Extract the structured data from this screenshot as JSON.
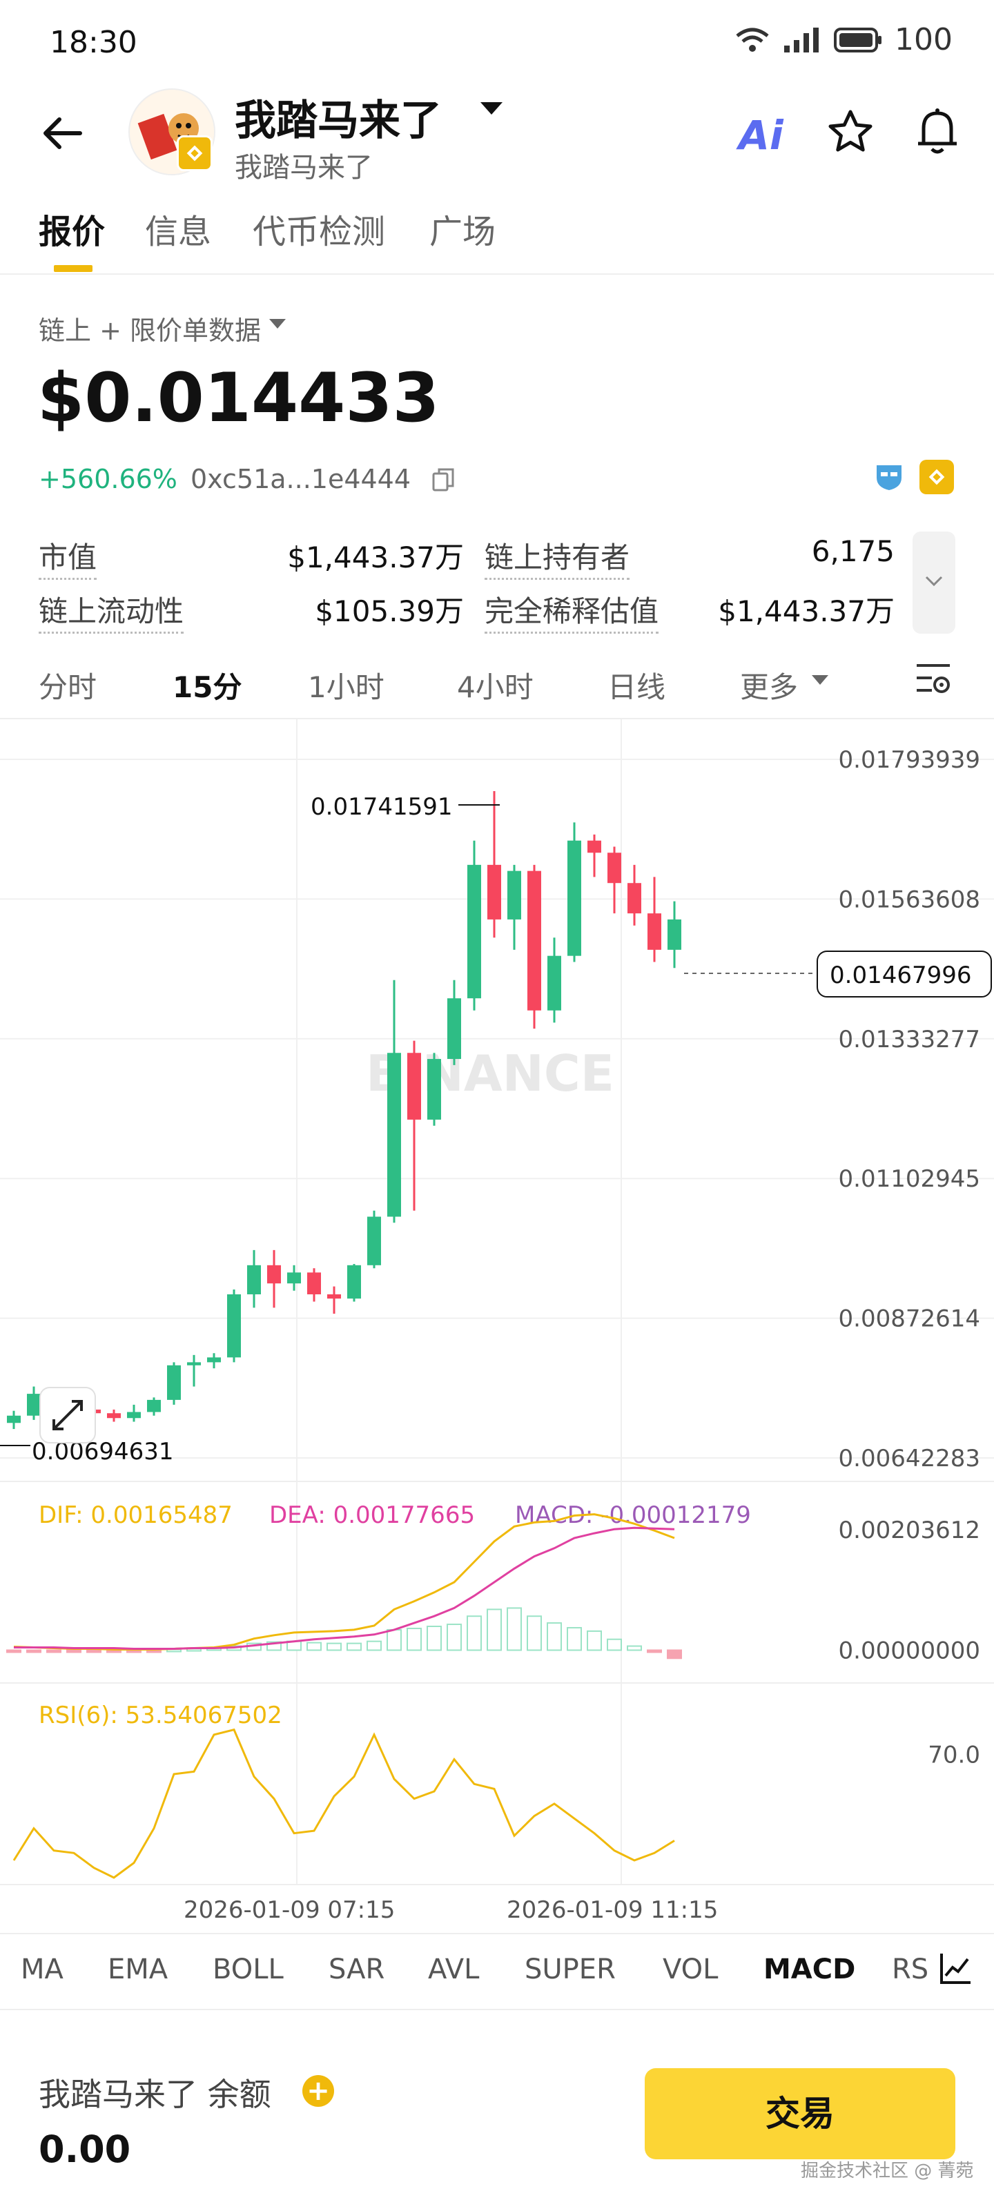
{
  "status_bar": {
    "time": "18:30",
    "battery": "100",
    "icons": [
      "wifi-icon",
      "signal-icon",
      "battery-icon"
    ]
  },
  "header": {
    "title": "我踏马来了",
    "subtitle": "我踏马来了",
    "ai_label": "Ai",
    "icons": [
      "back-arrow-icon",
      "ai-icon",
      "star-icon",
      "bell-icon"
    ]
  },
  "tabs": [
    {
      "label": "报价",
      "active": true
    },
    {
      "label": "信息",
      "active": false
    },
    {
      "label": "代币检测",
      "active": false
    },
    {
      "label": "广场",
      "active": false
    }
  ],
  "price_panel": {
    "data_source": "链上 + 限价单数据",
    "price": "$0.014433",
    "change": "+560.66%",
    "address": "0xc51a...1e4444"
  },
  "stats": {
    "market_cap_label": "市值",
    "market_cap": "$1,443.37万",
    "holders_label": "链上持有者",
    "holders": "6,175",
    "liquidity_label": "链上流动性",
    "liquidity": "$105.39万",
    "fdv_label": "完全稀释估值",
    "fdv": "$1,443.37万"
  },
  "intervals": [
    {
      "label": "分时",
      "active": false
    },
    {
      "label": "15分",
      "active": true
    },
    {
      "label": "1小时",
      "active": false
    },
    {
      "label": "4小时",
      "active": false
    },
    {
      "label": "日线",
      "active": false
    },
    {
      "label": "更多",
      "active": false
    }
  ],
  "chart_data": {
    "type": "candlestick",
    "price_axis_ticks": [
      "0.01793939",
      "0.01563608",
      "0.01333277",
      "0.01102945",
      "0.00872614",
      "0.00642283"
    ],
    "ylim": [
      0.00642283,
      0.01793939
    ],
    "high_label": "0.01741591",
    "low_label": "0.00694631",
    "current_price": "0.01467996",
    "watermark": "BINANCE",
    "colors": {
      "up": "#2ebd85",
      "down": "#f6465d",
      "dif": "#f0b90b",
      "dea": "#e040a0",
      "macd": "#9b59b6",
      "rsi": "#f0b90b"
    },
    "candles": [
      {
        "o": 0.007,
        "h": 0.0072,
        "l": 0.0069,
        "c": 0.00712
      },
      {
        "o": 0.00712,
        "h": 0.0076,
        "l": 0.00705,
        "c": 0.00748
      },
      {
        "o": 0.00748,
        "h": 0.00755,
        "l": 0.0072,
        "c": 0.00728
      },
      {
        "o": 0.00728,
        "h": 0.00738,
        "l": 0.00715,
        "c": 0.00722
      },
      {
        "o": 0.00722,
        "h": 0.00728,
        "l": 0.0071,
        "c": 0.00716
      },
      {
        "o": 0.00716,
        "h": 0.00722,
        "l": 0.00702,
        "c": 0.00708
      },
      {
        "o": 0.00708,
        "h": 0.0073,
        "l": 0.00702,
        "c": 0.00718
      },
      {
        "o": 0.00718,
        "h": 0.00742,
        "l": 0.00712,
        "c": 0.00738
      },
      {
        "o": 0.00738,
        "h": 0.008,
        "l": 0.0073,
        "c": 0.00795
      },
      {
        "o": 0.00795,
        "h": 0.00812,
        "l": 0.0076,
        "c": 0.008
      },
      {
        "o": 0.008,
        "h": 0.00815,
        "l": 0.0079,
        "c": 0.00808
      },
      {
        "o": 0.00808,
        "h": 0.0092,
        "l": 0.008,
        "c": 0.00912
      },
      {
        "o": 0.00912,
        "h": 0.00985,
        "l": 0.0089,
        "c": 0.0096
      },
      {
        "o": 0.0096,
        "h": 0.00985,
        "l": 0.0089,
        "c": 0.0093
      },
      {
        "o": 0.0093,
        "h": 0.0096,
        "l": 0.00918,
        "c": 0.00948
      },
      {
        "o": 0.00948,
        "h": 0.00955,
        "l": 0.009,
        "c": 0.00912
      },
      {
        "o": 0.00912,
        "h": 0.00925,
        "l": 0.0088,
        "c": 0.00905
      },
      {
        "o": 0.00905,
        "h": 0.00962,
        "l": 0.009,
        "c": 0.0096
      },
      {
        "o": 0.0096,
        "h": 0.0105,
        "l": 0.00955,
        "c": 0.0104
      },
      {
        "o": 0.0104,
        "h": 0.0143,
        "l": 0.0103,
        "c": 0.0131
      },
      {
        "o": 0.0131,
        "h": 0.0133,
        "l": 0.0105,
        "c": 0.012
      },
      {
        "o": 0.012,
        "h": 0.0131,
        "l": 0.0119,
        "c": 0.013
      },
      {
        "o": 0.013,
        "h": 0.0143,
        "l": 0.0129,
        "c": 0.014
      },
      {
        "o": 0.014,
        "h": 0.0166,
        "l": 0.0138,
        "c": 0.0162
      },
      {
        "o": 0.0162,
        "h": 0.01741591,
        "l": 0.015,
        "c": 0.0153
      },
      {
        "o": 0.0153,
        "h": 0.0162,
        "l": 0.0148,
        "c": 0.0161
      },
      {
        "o": 0.0161,
        "h": 0.0162,
        "l": 0.0135,
        "c": 0.0138
      },
      {
        "o": 0.0138,
        "h": 0.015,
        "l": 0.0136,
        "c": 0.0147
      },
      {
        "o": 0.0147,
        "h": 0.0169,
        "l": 0.0146,
        "c": 0.0166
      },
      {
        "o": 0.0166,
        "h": 0.0167,
        "l": 0.016,
        "c": 0.0164
      },
      {
        "o": 0.0164,
        "h": 0.0165,
        "l": 0.0154,
        "c": 0.0159
      },
      {
        "o": 0.0159,
        "h": 0.0162,
        "l": 0.0152,
        "c": 0.0154
      },
      {
        "o": 0.0154,
        "h": 0.016,
        "l": 0.0146,
        "c": 0.0148
      },
      {
        "o": 0.0148,
        "h": 0.0156,
        "l": 0.0145,
        "c": 0.0153
      }
    ],
    "macd_panel": {
      "dif_label": "DIF: 0.00165487",
      "dea_label": "DEA: 0.00177665",
      "macd_label": "MACD: -0.00012179",
      "axis_ticks": [
        "0.00203612",
        "0.00000000"
      ],
      "ylim": [
        -0.0003,
        0.00203612
      ],
      "dif": [
        5e-05,
        4e-05,
        3e-05,
        2e-05,
        2e-05,
        1e-05,
        1e-05,
        1e-05,
        2e-05,
        3e-05,
        4e-05,
        8e-05,
        0.00017,
        0.00022,
        0.00026,
        0.00027,
        0.00028,
        0.0003,
        0.00036,
        0.0006,
        0.00072,
        0.00085,
        0.001,
        0.0013,
        0.0016,
        0.00182,
        0.00188,
        0.0019,
        0.00198,
        0.002,
        0.00194,
        0.00186,
        0.00176,
        0.00165
      ],
      "dea": [
        4e-05,
        4e-05,
        4e-05,
        3e-05,
        3e-05,
        3e-05,
        2e-05,
        2e-05,
        2e-05,
        3e-05,
        3e-05,
        4e-05,
        7e-05,
        0.0001,
        0.00013,
        0.00016,
        0.00018,
        0.0002,
        0.00023,
        0.0003,
        0.0004,
        0.0005,
        0.00062,
        0.0008,
        0.001,
        0.0012,
        0.00138,
        0.0015,
        0.00165,
        0.00172,
        0.00178,
        0.0018,
        0.00179,
        0.00178
      ],
      "hist": [
        -3e-05,
        -3e-05,
        -2e-05,
        -2e-05,
        -2e-05,
        -2e-05,
        -2e-05,
        -2e-05,
        1e-05,
        2e-05,
        3e-05,
        6e-05,
        0.0001,
        0.00012,
        0.00013,
        0.00011,
        0.0001,
        0.0001,
        0.00013,
        0.0003,
        0.00032,
        0.00035,
        0.00038,
        0.0005,
        0.0006,
        0.00062,
        0.0005,
        0.0004,
        0.00033,
        0.00028,
        0.00016,
        6e-05,
        -3e-05,
        -0.00012
      ]
    },
    "rsi_panel": {
      "label": "RSI(6): 53.54067502",
      "axis_ticks": [
        "70.0"
      ],
      "ylim": [
        20,
        90
      ],
      "values": [
        27,
        40,
        31,
        30,
        24,
        20,
        26,
        40,
        62,
        63,
        78,
        80,
        61,
        52,
        38,
        39,
        53,
        61,
        78,
        60,
        52,
        55,
        68,
        58,
        56,
        37,
        45,
        50,
        44,
        38,
        31,
        27,
        30,
        35
      ]
    },
    "time_labels": [
      "2026-01-09 07:15",
      "2026-01-09 11:15"
    ]
  },
  "indicator_tabs": [
    {
      "label": "MA",
      "active": false
    },
    {
      "label": "EMA",
      "active": false
    },
    {
      "label": "BOLL",
      "active": false
    },
    {
      "label": "SAR",
      "active": false
    },
    {
      "label": "AVL",
      "active": false
    },
    {
      "label": "SUPER",
      "active": false
    },
    {
      "label": "VOL",
      "active": false
    },
    {
      "label": "MACD",
      "active": true
    },
    {
      "label": "RS",
      "active": false
    }
  ],
  "footer": {
    "balance_label": "我踏马来了 余额",
    "balance_value": "0.00",
    "trade_label": "交易",
    "watermark": "掘金技术社区 @ 菁菀"
  }
}
